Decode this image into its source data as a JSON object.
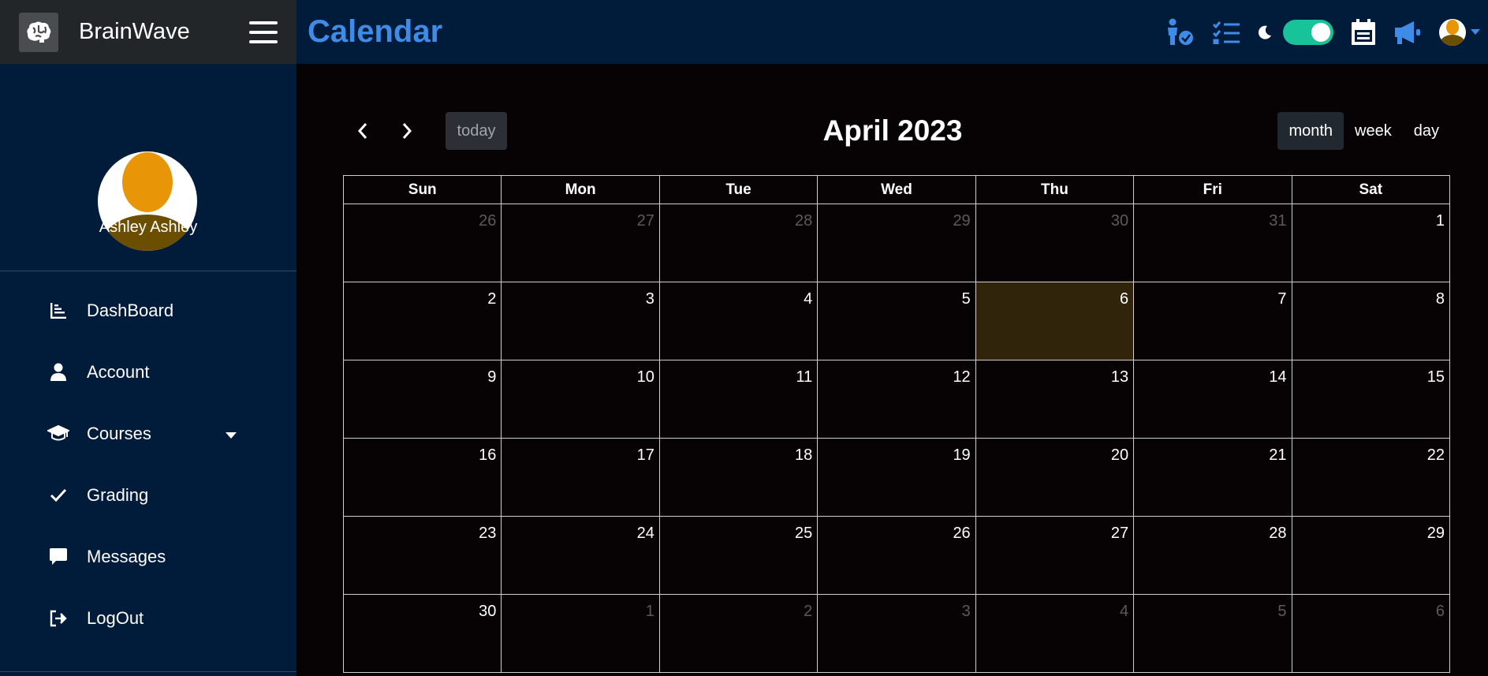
{
  "brand": {
    "name": "BrainWave"
  },
  "header": {
    "title": "Calendar"
  },
  "profile": {
    "name": "Ashley Ashley"
  },
  "sidebar": {
    "items": [
      {
        "label": "DashBoard",
        "icon": "chart-icon"
      },
      {
        "label": "Account",
        "icon": "user-icon"
      },
      {
        "label": "Courses",
        "icon": "graduation-cap-icon"
      },
      {
        "label": "Grading",
        "icon": "check-icon"
      },
      {
        "label": "Messages",
        "icon": "message-icon"
      },
      {
        "label": "LogOut",
        "icon": "logout-icon"
      }
    ]
  },
  "topbar": {
    "icons": [
      "person-check-icon",
      "task-list-icon",
      "moon-icon",
      "theme-toggle",
      "calendar-icon",
      "megaphone-icon",
      "user-avatar"
    ],
    "theme_toggle_on": true
  },
  "calendar": {
    "title": "April 2023",
    "today_label": "today",
    "views": [
      "month",
      "week",
      "day"
    ],
    "active_view": "month",
    "weekdays": [
      "Sun",
      "Mon",
      "Tue",
      "Wed",
      "Thu",
      "Fri",
      "Sat"
    ],
    "weeks": [
      [
        {
          "d": "26",
          "o": true
        },
        {
          "d": "27",
          "o": true
        },
        {
          "d": "28",
          "o": true
        },
        {
          "d": "29",
          "o": true
        },
        {
          "d": "30",
          "o": true
        },
        {
          "d": "31",
          "o": true
        },
        {
          "d": "1"
        }
      ],
      [
        {
          "d": "2"
        },
        {
          "d": "3"
        },
        {
          "d": "4"
        },
        {
          "d": "5"
        },
        {
          "d": "6",
          "t": true
        },
        {
          "d": "7"
        },
        {
          "d": "8"
        }
      ],
      [
        {
          "d": "9"
        },
        {
          "d": "10"
        },
        {
          "d": "11"
        },
        {
          "d": "12"
        },
        {
          "d": "13"
        },
        {
          "d": "14"
        },
        {
          "d": "15"
        }
      ],
      [
        {
          "d": "16"
        },
        {
          "d": "17"
        },
        {
          "d": "18"
        },
        {
          "d": "19"
        },
        {
          "d": "20"
        },
        {
          "d": "21"
        },
        {
          "d": "22"
        }
      ],
      [
        {
          "d": "23"
        },
        {
          "d": "24"
        },
        {
          "d": "25"
        },
        {
          "d": "26"
        },
        {
          "d": "27"
        },
        {
          "d": "28"
        },
        {
          "d": "29"
        }
      ],
      [
        {
          "d": "30"
        },
        {
          "d": "1",
          "o": true
        },
        {
          "d": "2",
          "o": true
        },
        {
          "d": "3",
          "o": true
        },
        {
          "d": "4",
          "o": true
        },
        {
          "d": "5",
          "o": true
        },
        {
          "d": "6",
          "o": true
        }
      ]
    ]
  },
  "colors": {
    "accent": "#3f8ce8",
    "sidebar_bg": "#011b3a",
    "today_bg": "#30250b",
    "toggle_on": "#19c39a",
    "page_bg": "#070203"
  }
}
